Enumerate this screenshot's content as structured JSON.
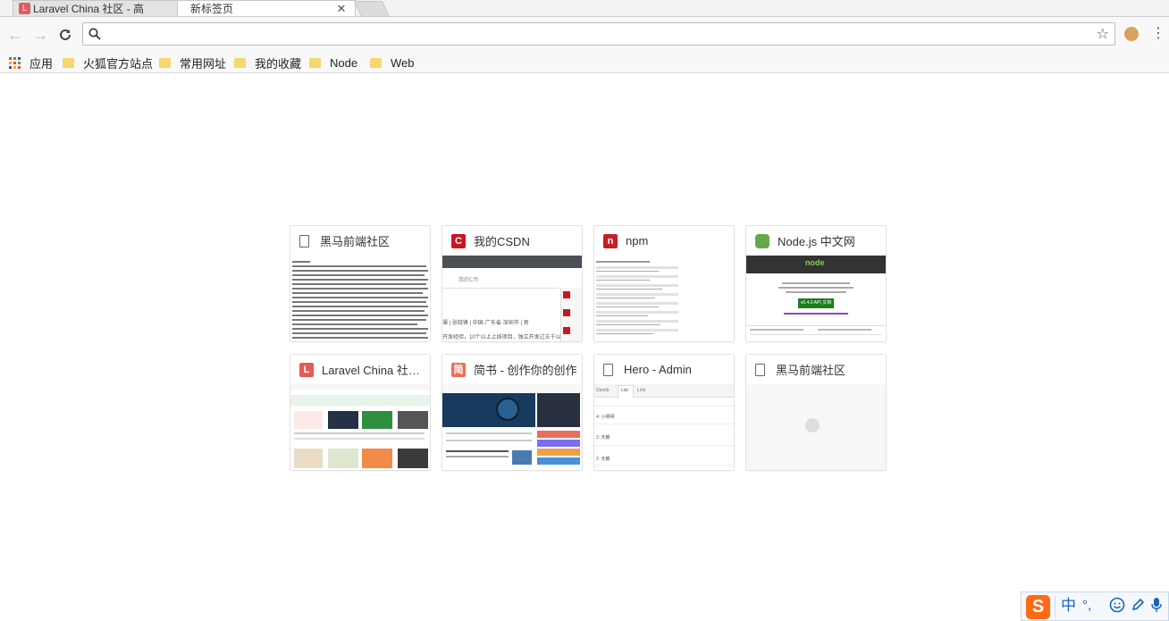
{
  "tabs": [
    {
      "title": "Laravel China 社区 - 高",
      "active": false
    },
    {
      "title": "新标签页",
      "active": true
    }
  ],
  "toolbar": {
    "back_icon": "arrow-left-icon",
    "forward_icon": "arrow-right-icon",
    "reload_icon": "reload-icon",
    "address_value": "",
    "address_placeholder": ""
  },
  "bookmarks": [
    {
      "label": "应用",
      "type": "apps"
    },
    {
      "label": "火狐官方站点",
      "type": "folder"
    },
    {
      "label": "常用网址",
      "type": "folder"
    },
    {
      "label": "我的收藏",
      "type": "folder"
    },
    {
      "label": "Node",
      "type": "folder"
    },
    {
      "label": "Web",
      "type": "folder"
    }
  ],
  "most_visited": [
    {
      "title": "黑马前端社区",
      "icon": "page-icon"
    },
    {
      "title": "我的CSDN",
      "icon": "csdn-icon",
      "icon_color": "#c81623"
    },
    {
      "title": "npm",
      "icon": "npm-icon",
      "icon_color": "#c12127"
    },
    {
      "title": "Node.js 中文网",
      "icon": "nodejs-icon",
      "icon_color": "#66a84b"
    },
    {
      "title": "Laravel China 社区 ...",
      "icon": "laravel-icon",
      "icon_color": "#e55b5b"
    },
    {
      "title": "简书 - 创作你的创作",
      "icon": "jianshu-icon",
      "icon_color": "#ea6f5a"
    },
    {
      "title": "Hero - Admin",
      "icon": "page-icon"
    },
    {
      "title": "黑马前端社区",
      "icon": "page-icon"
    }
  ],
  "thumbs": {
    "csdn_line1": "我的C币",
    "csdn_line2": "课  |  张晓锋  |  中国·广东省·深圳市  |  男",
    "csdn_line3": "开发经验，10个以上上线项目，独立开发过五千以上的",
    "hero_tabs": [
      "Dashb",
      "List",
      "Link"
    ],
    "hero_rows": [
      "4: 小明明",
      "2: 天朗",
      "2: 天朗"
    ],
    "node_version": "v6.4.0 API 文档"
  },
  "ime": {
    "logo": "S",
    "lang": "中",
    "punct": "°,",
    "icons": [
      "emoji-icon",
      "pen-icon",
      "mic-icon"
    ]
  }
}
